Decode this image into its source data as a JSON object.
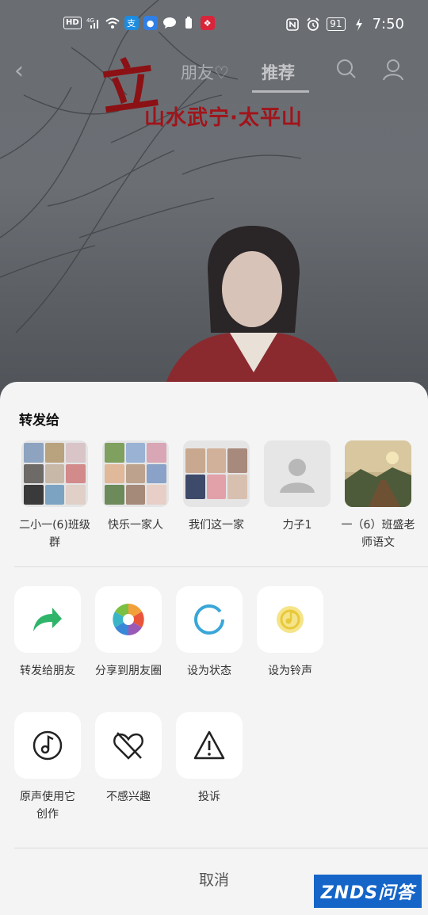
{
  "status_bar": {
    "left_badges": [
      "HD",
      "4G"
    ],
    "battery": "91",
    "time": "7:50"
  },
  "top_nav": {
    "tab_friends": "朋友♡",
    "tab_recommend": "推荐"
  },
  "video": {
    "title_overlay": "山水武宁·太平山",
    "calligraphy": "立"
  },
  "share_sheet": {
    "title": "转发给",
    "contacts": [
      {
        "name": "二小一(6)班级群"
      },
      {
        "name": "快乐一家人"
      },
      {
        "name": "我们这一家"
      },
      {
        "name": "力子1"
      },
      {
        "name": "一（6）班盛老师语文"
      }
    ],
    "actions_row1": [
      {
        "label": "转发给朋友",
        "icon": "forward-arrow-icon"
      },
      {
        "label": "分享到朋友圈",
        "icon": "moments-aperture-icon"
      },
      {
        "label": "设为状态",
        "icon": "status-ring-icon"
      },
      {
        "label": "设为铃声",
        "icon": "ringtone-icon"
      }
    ],
    "actions_row2": [
      {
        "label": "原声使用它创作",
        "icon": "music-note-icon"
      },
      {
        "label": "不感兴趣",
        "icon": "broken-heart-icon"
      },
      {
        "label": "投诉",
        "icon": "warning-icon"
      }
    ],
    "cancel": "取消"
  },
  "watermark": "ZNDS问答",
  "colors": {
    "sheet_bg": "#f4f4f4",
    "forward_green": "#2fb56a",
    "status_blue": "#3aa6d8",
    "ringtone_yellow": "#e8c93a"
  }
}
